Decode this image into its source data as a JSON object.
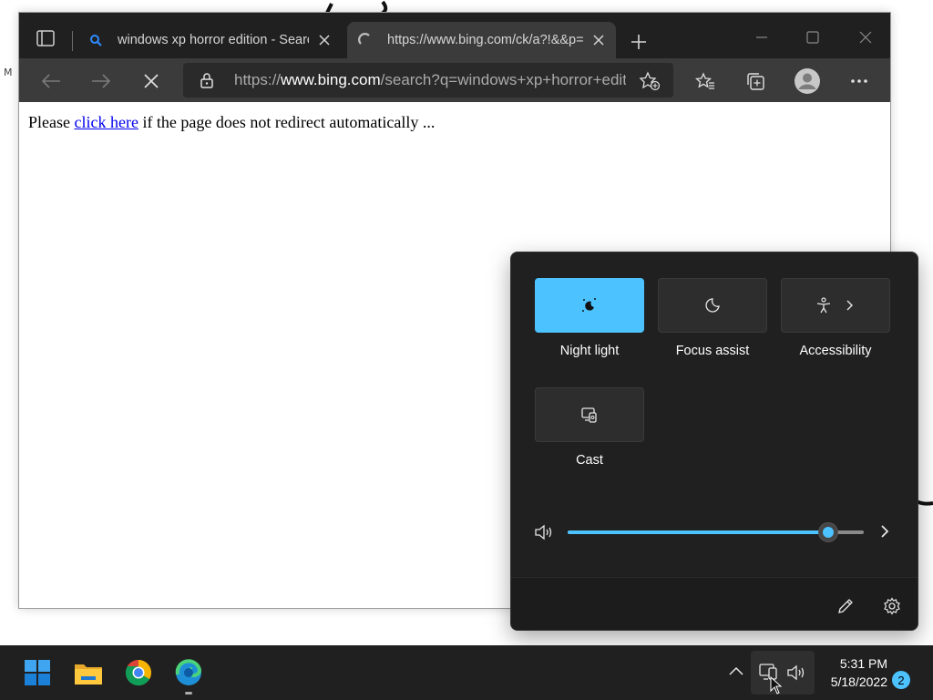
{
  "desktop": {
    "stray_text": "M"
  },
  "browser": {
    "tabs": [
      {
        "title": "windows xp horror edition - Search",
        "active": false
      },
      {
        "title": "https://www.bing.com/ck/a?!&&p=",
        "active": true
      }
    ],
    "address": {
      "prefix": "https://",
      "domain": "www.bing.com",
      "rest": "/search?q=windows+xp+horror+edition"
    },
    "page": {
      "text_before": "Please ",
      "link_text": "click here",
      "text_after": " if the page does not redirect automatically ..."
    }
  },
  "quick_settings": {
    "tiles": [
      {
        "label": "Night light",
        "icon": "night-light-icon",
        "active": true
      },
      {
        "label": "Focus assist",
        "icon": "moon-icon",
        "active": false
      },
      {
        "label": "Accessibility",
        "icon": "accessibility-icon",
        "active": false
      },
      {
        "label": "Cast",
        "icon": "cast-icon",
        "active": false
      }
    ],
    "volume": {
      "level": 0.88
    },
    "accent": "#4cc2ff"
  },
  "taskbar": {
    "apps": [
      "start-icon",
      "file-explorer-icon",
      "chrome-icon",
      "edge-icon"
    ],
    "clock": {
      "time": "5:31 PM",
      "date": "5/18/2022"
    },
    "notifications": "2"
  }
}
